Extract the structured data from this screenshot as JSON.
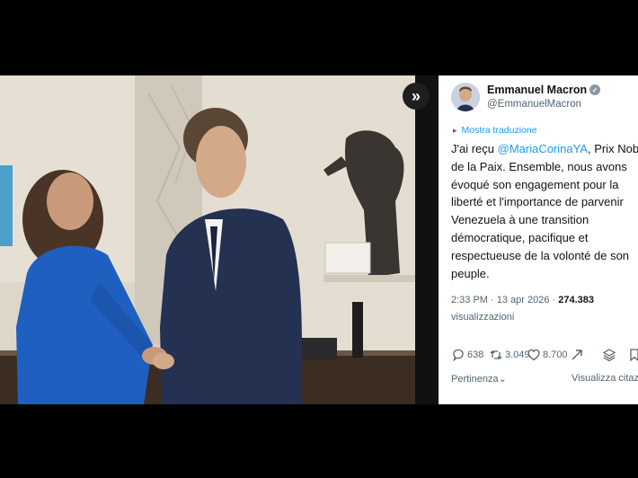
{
  "controls": {
    "expand_icon_glyph": "»"
  },
  "author": {
    "name": "Emmanuel Macron",
    "handle": "@EmmanuelMacron",
    "verified_icon": "verified-badge-icon"
  },
  "translate": {
    "label": "Mostra traduzione"
  },
  "tweet": {
    "line1_pre": "J'ai reçu ",
    "line1_mention": "@MariaCorinaYA",
    "line1_post": ", Prix Nobel",
    "line2": "de la Paix. Ensemble, nous avons",
    "line3": "évoqué son engagement pour la",
    "line4": "liberté et l'importance de parvenir",
    "line5": "Venezuela à une transition",
    "line6": "démocratique, pacifique et",
    "line7": "respectueuse de la volonté de son",
    "line8": "peuple."
  },
  "meta": {
    "time": "2:33 PM · 13 apr 2026 · ",
    "views": "274.383",
    "views_label": "visualizzazioni"
  },
  "actions": {
    "replies": "638",
    "reposts": "3.049",
    "likes": "8.700",
    "icons": [
      "reply-icon",
      "repost-icon",
      "like-icon",
      "grok-icon",
      "layers-icon",
      "bookmark-icon"
    ]
  },
  "footer": {
    "sort_label": "Pertinenza",
    "quotes_label": "Visualizza citazioni"
  },
  "colors": {
    "accent": "#1d9bf0",
    "muted": "#536471",
    "text": "#0f1419"
  }
}
